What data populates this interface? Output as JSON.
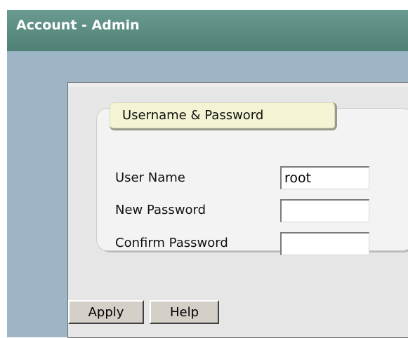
{
  "window": {
    "title": "Account - Admin"
  },
  "group": {
    "legend": "Username & Password"
  },
  "fields": {
    "username": {
      "label": "User Name",
      "value": "root"
    },
    "new_password": {
      "label": "New Password",
      "value": ""
    },
    "confirm_password": {
      "label": "Confirm Password",
      "value": ""
    }
  },
  "buttons": {
    "apply": "Apply",
    "help": "Help"
  },
  "colors": {
    "title_bar": "#5f8f85",
    "page_background": "#9db5c5",
    "panel_background": "#e6e6e6",
    "legend_background": "#f4f4d4"
  }
}
